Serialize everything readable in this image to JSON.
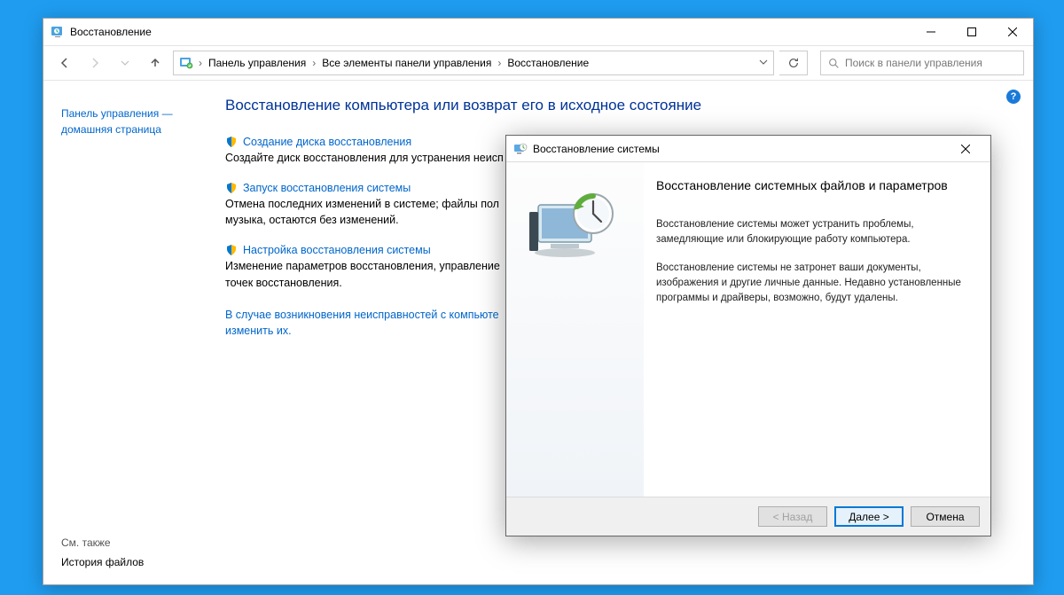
{
  "window": {
    "title": "Восстановление"
  },
  "breadcrumb": {
    "root": "Панель управления",
    "all": "Все элементы панели управления",
    "current": "Восстановление"
  },
  "search": {
    "placeholder": "Поиск в панели управления"
  },
  "sidebar": {
    "cp_home_line1": "Панель управления —",
    "cp_home_line2": "домашняя страница",
    "see_also": "См. также",
    "file_history": "История файлов"
  },
  "main": {
    "heading": "Восстановление компьютера или возврат его в исходное состояние",
    "sections": [
      {
        "link": "Создание диска восстановления",
        "desc": "Создайте диск восстановления для устранения неисп"
      },
      {
        "link": "Запуск восстановления системы",
        "desc": "Отмена последних изменений в системе; файлы пол\nмузыка, остаются без изменений."
      },
      {
        "link": "Настройка восстановления системы",
        "desc": "Изменение параметров восстановления, управление\nточек восстановления."
      }
    ],
    "trouble_line": "В случае возникновения неисправностей с компьюте\nизменить их."
  },
  "dialog": {
    "title": "Восстановление системы",
    "heading": "Восстановление системных файлов и параметров",
    "p1": "Восстановление системы может устранить проблемы, замедляющие или блокирующие работу компьютера.",
    "p2": "Восстановление системы не затронет ваши документы, изображения и другие личные данные. Недавно установленные программы и драйверы, возможно, будут удалены.",
    "back": "< Назад",
    "next": "Далее >",
    "cancel": "Отмена"
  }
}
